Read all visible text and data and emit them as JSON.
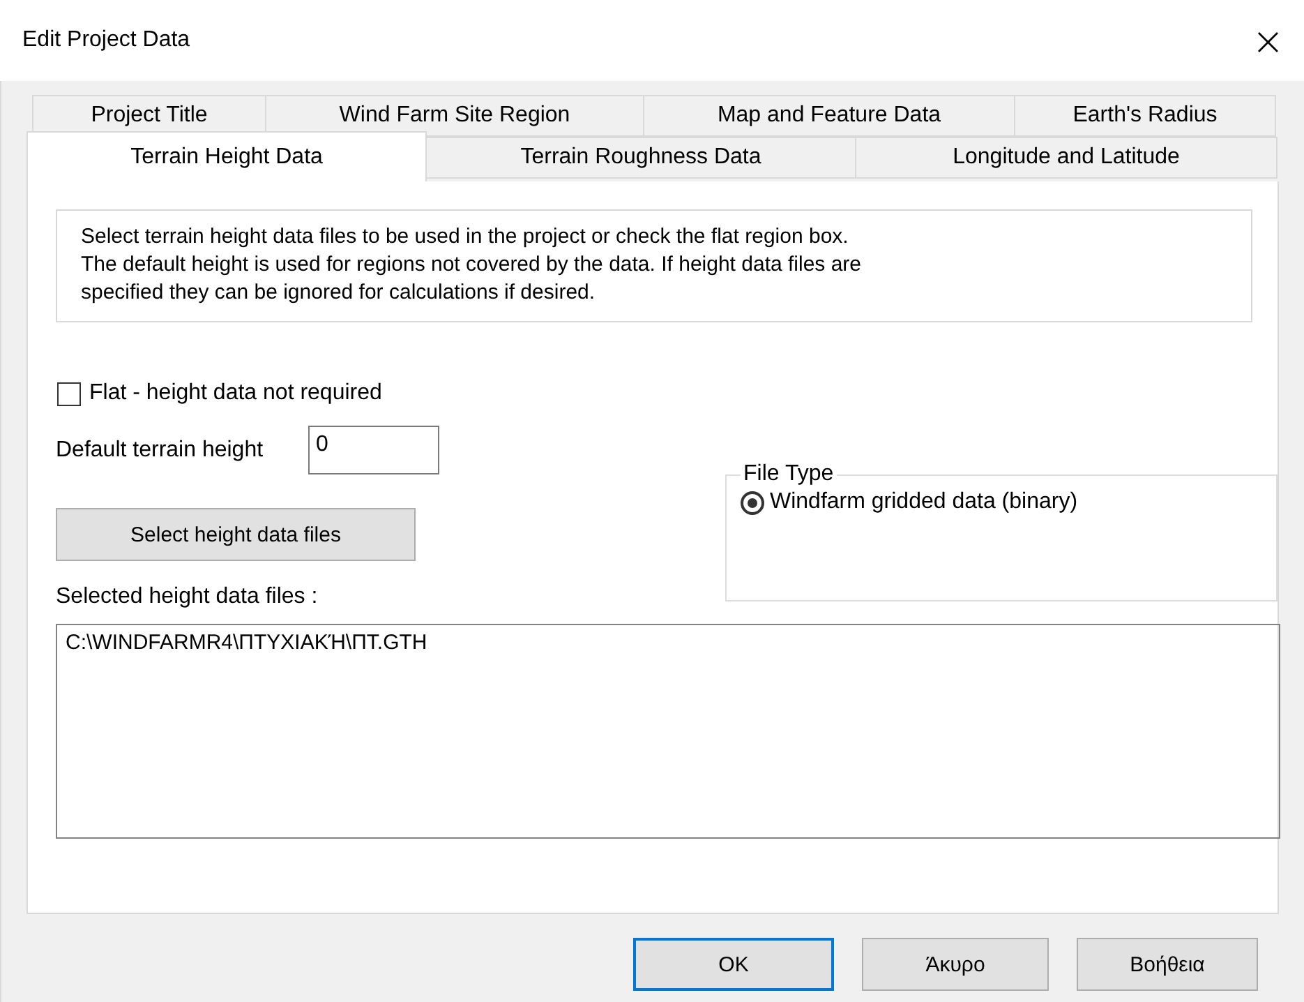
{
  "window": {
    "title": "Edit Project Data",
    "close": "×"
  },
  "tabs": {
    "back_row": [
      {
        "label": "Project Title",
        "selected": false
      },
      {
        "label": "Wind Farm Site Region",
        "selected": false
      },
      {
        "label": "Map and Feature Data",
        "selected": false
      },
      {
        "label": "Earth's Radius",
        "selected": false
      }
    ],
    "front_row": [
      {
        "label": "Terrain Height Data",
        "selected": true
      },
      {
        "label": "Terrain Roughness Data",
        "selected": false
      },
      {
        "label": "Longitude and Latitude",
        "selected": false
      }
    ]
  },
  "description": "Select terrain height data files to be used in the project or check the flat region box.\nThe default height is used for regions not covered by the data.  If height data files are\nspecified they can be ignored for calculations if desired.",
  "flat_checkbox": {
    "label": "Flat - height data not required",
    "checked": false
  },
  "default_height": {
    "label": "Default terrain height",
    "value": "0"
  },
  "select_button": "Select height data files",
  "file_type": {
    "title": "File Type",
    "options": [
      {
        "label": "Windfarm gridded data (binary)",
        "selected": true
      }
    ]
  },
  "selected_files": {
    "label": "Selected height data files :",
    "files": [
      "C:\\WINDFARMR4\\ΠΤΥΧΙΑΚΉ\\ΠΤ.GTH"
    ]
  },
  "buttons": [
    {
      "label": "OK",
      "default": true
    },
    {
      "label": "Άκυρο",
      "default": false
    },
    {
      "label": "Βοήθεια",
      "default": false
    }
  ]
}
